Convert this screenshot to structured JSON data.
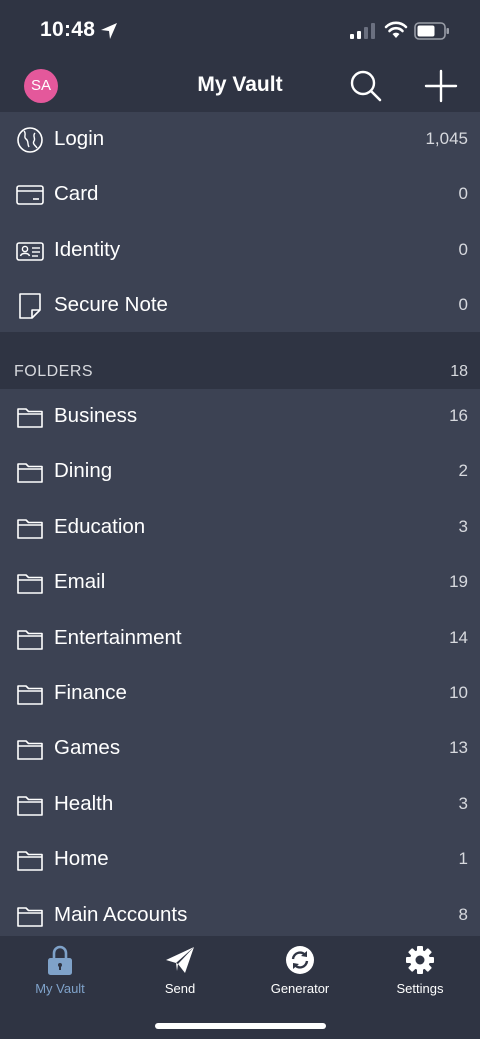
{
  "status_bar": {
    "time": "10:48"
  },
  "header": {
    "avatar_initials": "SA",
    "title": "My Vault",
    "avatar_color": "#e4589b"
  },
  "types": [
    {
      "label": "Login",
      "count": "1,045",
      "icon": "globe-icon"
    },
    {
      "label": "Card",
      "count": "0",
      "icon": "card-icon"
    },
    {
      "label": "Identity",
      "count": "0",
      "icon": "identity-icon"
    },
    {
      "label": "Secure Note",
      "count": "0",
      "icon": "note-icon"
    }
  ],
  "folders_section": {
    "title": "FOLDERS",
    "count": "18"
  },
  "folders": [
    {
      "label": "Business",
      "count": "16"
    },
    {
      "label": "Dining",
      "count": "2"
    },
    {
      "label": "Education",
      "count": "3"
    },
    {
      "label": "Email",
      "count": "19"
    },
    {
      "label": "Entertainment",
      "count": "14"
    },
    {
      "label": "Finance",
      "count": "10"
    },
    {
      "label": "Games",
      "count": "13"
    },
    {
      "label": "Health",
      "count": "3"
    },
    {
      "label": "Home",
      "count": "1"
    },
    {
      "label": "Main Accounts",
      "count": "8"
    }
  ],
  "tabs": [
    {
      "label": "My Vault",
      "icon": "lock-icon",
      "active": true
    },
    {
      "label": "Send",
      "icon": "paper-plane-icon",
      "active": false
    },
    {
      "label": "Generator",
      "icon": "refresh-icon",
      "active": false
    },
    {
      "label": "Settings",
      "icon": "gear-icon",
      "active": false
    }
  ],
  "colors": {
    "background": "#3c4253",
    "header_background": "#2f3443",
    "active_tab": "#7fa2c9"
  }
}
